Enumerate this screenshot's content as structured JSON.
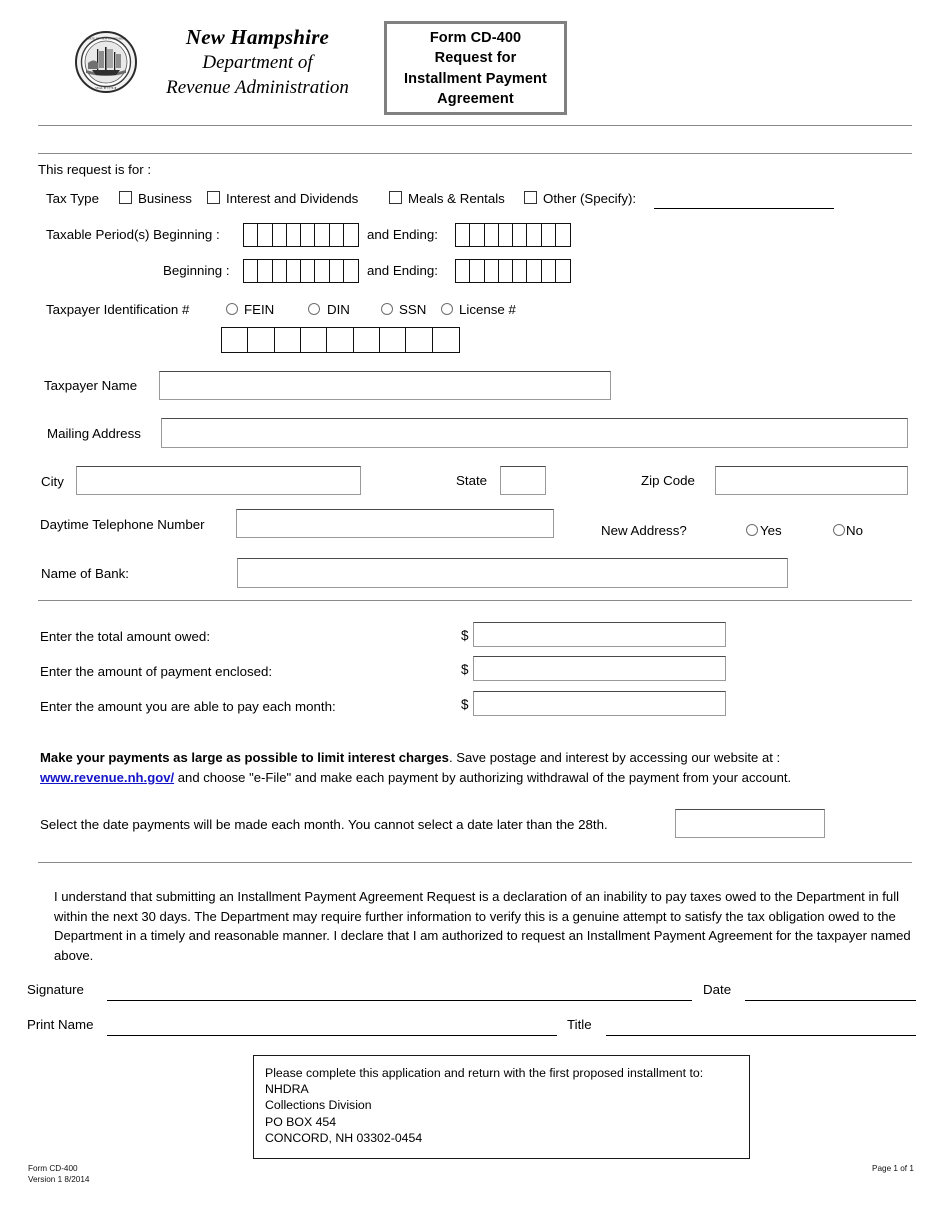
{
  "header": {
    "seal_icon": "nh-state-seal-icon",
    "agency_line1": "New Hampshire",
    "agency_line2": "Department of",
    "agency_line3": "Revenue Administration",
    "form_title_line1": "Form CD-400",
    "form_title_line2": "Request for",
    "form_title_line3": "Installment Payment",
    "form_title_line4": "Agreement"
  },
  "request": {
    "intro": "This request is for :",
    "tax_type_label": "Tax Type",
    "tax_types": [
      {
        "label": "Business",
        "checked": false
      },
      {
        "label": "Interest and Dividends",
        "checked": false
      },
      {
        "label": "Meals & Rentals",
        "checked": false
      },
      {
        "label": "Other (Specify):",
        "checked": false
      }
    ],
    "other_specify_value": ""
  },
  "taxable_period": {
    "row1_label": "Taxable Period(s) Beginning :",
    "row2_label": "Beginning :",
    "ending_label": "and Ending:",
    "box_count": 8,
    "row1_begin_value": "",
    "row1_end_value": "",
    "row2_begin_value": "",
    "row2_end_value": ""
  },
  "taxpayer_id": {
    "label": "Taxpayer Identification #",
    "options": [
      {
        "label": "FEIN",
        "selected": false
      },
      {
        "label": "DIN",
        "selected": false
      },
      {
        "label": "SSN",
        "selected": false
      },
      {
        "label": "License #",
        "selected": false
      }
    ],
    "box_count": 9,
    "value": ""
  },
  "taxpayer": {
    "name_label": "Taxpayer Name",
    "name_value": "",
    "address_label": "Mailing Address",
    "address_value": "",
    "city_label": "City",
    "city_value": "",
    "state_label": "State",
    "state_value": "",
    "zip_label": "Zip Code",
    "zip_value": "",
    "phone_label": "Daytime Telephone Number",
    "phone_value": "",
    "new_address_label": "New Address?",
    "new_address_yes": "Yes",
    "new_address_no": "No",
    "new_address_selected": "",
    "bank_label": "Name of Bank:",
    "bank_value": ""
  },
  "amounts": {
    "currency_symbol": "$",
    "rows": [
      {
        "label": "Enter the total amount owed:",
        "value": ""
      },
      {
        "label": "Enter the amount of payment enclosed:",
        "value": ""
      },
      {
        "label": "Enter the amount you are able to pay each month:",
        "value": ""
      }
    ]
  },
  "instructions": {
    "bold_lead": "Make your payments as large as possible to limit interest charges",
    "after_bold": ". Save postage and interest by accessing our website at :",
    "link_text": "www.revenue.nh.gov/",
    "after_link": " and choose \"e-File\" and make each payment by authorizing withdrawal of the payment from your account.",
    "date_select_text": "Select the date payments will be made each month. You cannot select a date later than the 28th.",
    "date_select_value": ""
  },
  "declaration": {
    "text": "I understand that submitting an Installment Payment Agreement Request is a declaration of an inability to pay taxes owed to the Department in full within the next 30 days. The Department may require further information to verify this is a genuine attempt to satisfy the tax obligation owed to the Department in a timely and reasonable manner. I declare that I am authorized to request an Installment Payment Agreement for the taxpayer named above."
  },
  "signature": {
    "signature_label": "Signature",
    "signature_value": "",
    "date_label": "Date",
    "date_value": "",
    "print_name_label": "Print Name",
    "print_name_value": "",
    "title_label": "Title",
    "title_value": ""
  },
  "mail_to": {
    "line1": "Please complete this application and return with the first proposed installment to:",
    "line2": "NHDRA",
    "line3": "Collections Division",
    "line4": "PO BOX 454",
    "line5": "CONCORD, NH 03302-0454"
  },
  "footer": {
    "form_id": "Form CD-400",
    "version": "Version 1 8/2014",
    "page": "Page 1 of 1"
  },
  "colors": {
    "link": "#1414c8",
    "box_border": "#9a9a9a",
    "rule": "#8a8a8a"
  }
}
